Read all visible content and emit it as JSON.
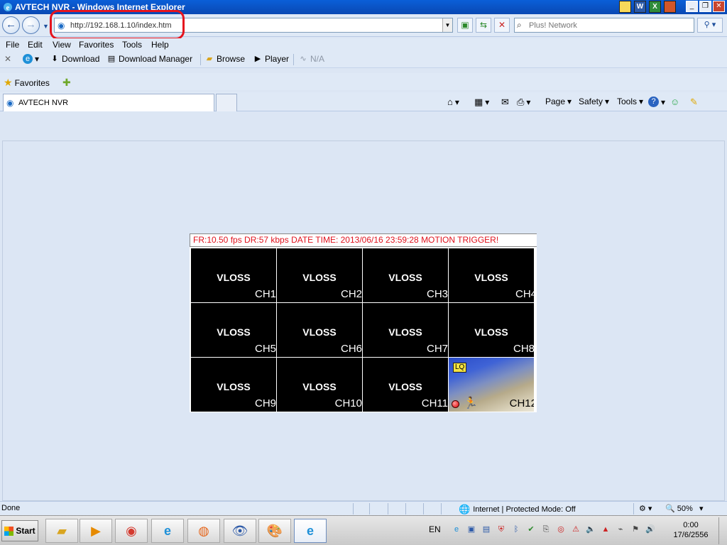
{
  "window": {
    "title": "AVTECH NVR - Windows Internet Explorer",
    "office_icons": [
      "",
      "W",
      "X",
      ""
    ],
    "controls": [
      "_",
      "❐",
      "✕"
    ]
  },
  "nav": {
    "back": "←",
    "forward": "→",
    "url": "http://192.168.1.10/index.htm",
    "search_placeholder": "Plus! Network"
  },
  "menu": [
    "File",
    "Edit",
    "View",
    "Favorites",
    "Tools",
    "Help"
  ],
  "toolbar": {
    "download": "Download",
    "download_manager": "Download Manager",
    "browse": "Browse",
    "player": "Player",
    "na": "N/A"
  },
  "favorites": {
    "label": "Favorites"
  },
  "tab": {
    "label": "AVTECH NVR"
  },
  "commands": {
    "page": "Page",
    "safety": "Safety",
    "tools": "Tools"
  },
  "nvr": {
    "status": "FR:10.50 fps  DR:57 kbps  DATE TIME: 2013/06/16 23:59:28  MOTION TRIGGER!",
    "lq": "LQ",
    "channels": [
      {
        "label": "CH1",
        "state": "VLOSS"
      },
      {
        "label": "CH2",
        "state": "VLOSS"
      },
      {
        "label": "CH3",
        "state": "VLOSS"
      },
      {
        "label": "CH4",
        "state": "VLOSS"
      },
      {
        "label": "CH5",
        "state": "VLOSS"
      },
      {
        "label": "CH6",
        "state": "VLOSS"
      },
      {
        "label": "CH7",
        "state": "VLOSS"
      },
      {
        "label": "CH8",
        "state": "VLOSS"
      },
      {
        "label": "CH9",
        "state": "VLOSS"
      },
      {
        "label": "CH10",
        "state": "VLOSS"
      },
      {
        "label": "CH11",
        "state": "VLOSS"
      },
      {
        "label": "CH12",
        "state": ""
      }
    ]
  },
  "statusbar": {
    "done": "Done",
    "zone": "Internet | Protected Mode: Off",
    "zoom": "50%"
  },
  "taskbar": {
    "start": "Start",
    "lang": "EN",
    "time": "0:00",
    "date": "17/6/2556"
  },
  "colors": {
    "alert_red": "#e0121d",
    "annotation_red": "#e5141e",
    "lq_yellow": "#f5e342"
  }
}
